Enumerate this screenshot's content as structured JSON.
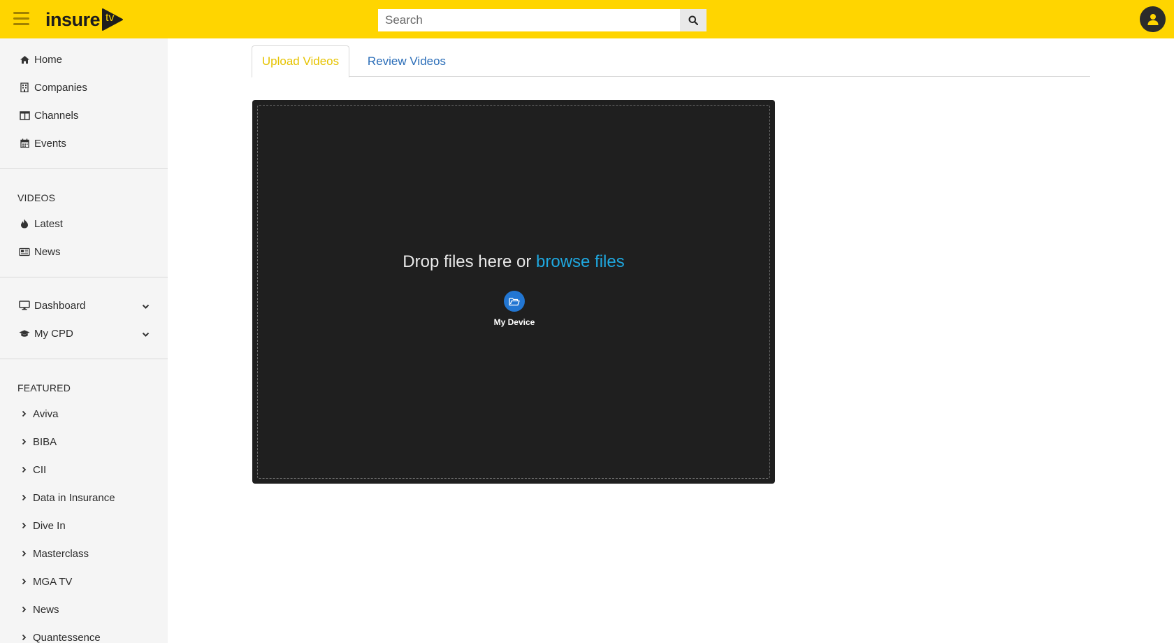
{
  "header": {
    "logo_text": "insure",
    "logo_suffix": "tv",
    "search_placeholder": "Search",
    "brand_color": "#ffd500"
  },
  "sidebar": {
    "main_items": [
      {
        "label": "Home",
        "icon": "home-icon"
      },
      {
        "label": "Companies",
        "icon": "building-icon"
      },
      {
        "label": "Channels",
        "icon": "columns-icon"
      },
      {
        "label": "Events",
        "icon": "calendar-icon"
      }
    ],
    "videos_title": "VIDEOS",
    "videos_items": [
      {
        "label": "Latest",
        "icon": "fire-icon"
      },
      {
        "label": "News",
        "icon": "newspaper-icon"
      }
    ],
    "account_items": [
      {
        "label": "Dashboard",
        "icon": "desktop-icon"
      },
      {
        "label": "My CPD",
        "icon": "graduation-cap-icon"
      }
    ],
    "featured_title": "FEATURED",
    "featured_items": [
      {
        "label": "Aviva"
      },
      {
        "label": "BIBA"
      },
      {
        "label": "CII"
      },
      {
        "label": "Data in Insurance"
      },
      {
        "label": "Dive In"
      },
      {
        "label": "Masterclass"
      },
      {
        "label": "MGA TV"
      },
      {
        "label": "News"
      },
      {
        "label": "Quantessence"
      }
    ]
  },
  "tabs": [
    {
      "label": "Upload Videos",
      "active": true
    },
    {
      "label": "Review Videos",
      "active": false
    }
  ],
  "dropzone": {
    "text_prefix": "Drop files here or",
    "browse_label": "browse files",
    "device_label": "My Device",
    "accent_color": "#1fa8e0"
  }
}
